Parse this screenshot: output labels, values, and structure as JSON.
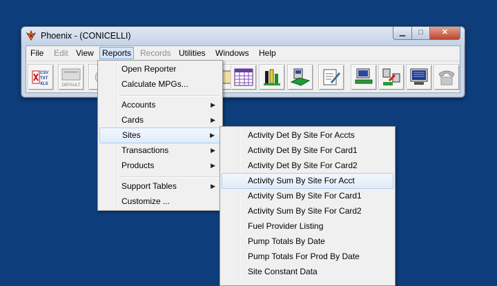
{
  "window": {
    "title": "Phoenix - (CONICELLI)"
  },
  "menubar": [
    "File",
    "Edit",
    "View",
    "Reports",
    "Records",
    "Utilities",
    "Windows",
    "Help"
  ],
  "toolbar": {
    "csv_lines": [
      "CSV",
      "TXT",
      "XLS"
    ],
    "default_label": "DEFAULT"
  },
  "reports_menu": {
    "group1": [
      "Open Reporter",
      "Calculate MPGs..."
    ],
    "group2": [
      "Accounts",
      "Cards",
      "Sites",
      "Transactions",
      "Products"
    ],
    "group3": [
      "Support Tables",
      "Customize ..."
    ]
  },
  "sites_menu": [
    "Activity Det By Site For Accts",
    "Activity Det By Site For Card1",
    "Activity Det By Site For Card2",
    "Activity Sum By Site For Acct",
    "Activity Sum By Site For Card1",
    "Activity Sum By Site For Card2",
    "Fuel Provider Listing",
    "Pump Totals By Date",
    "Pump Totals For Prod By Date",
    "Site Constant Data"
  ],
  "colors": {
    "desktop": "#0d3d7a",
    "highlight": "#e1ecfa"
  }
}
